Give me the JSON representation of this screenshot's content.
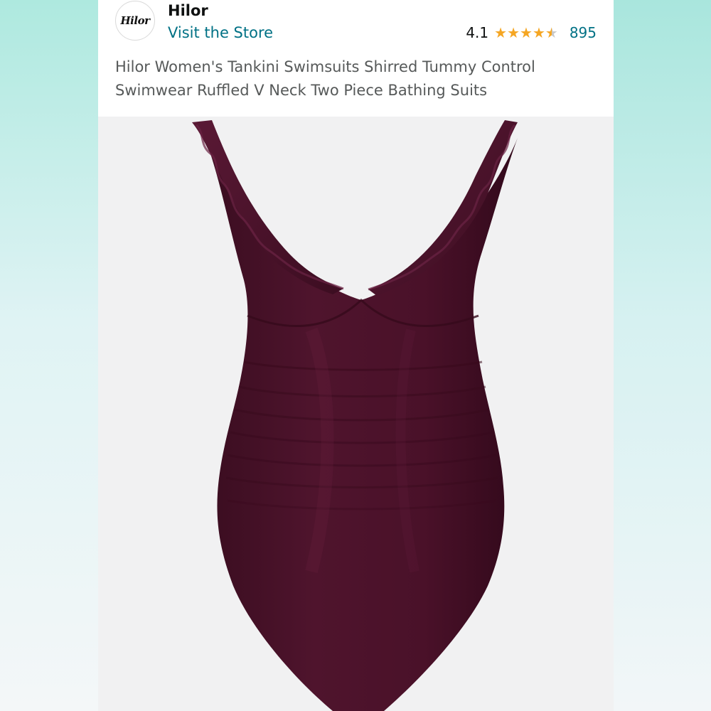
{
  "brand": {
    "logo_text": "Hilor",
    "name": "Hilor",
    "visit_store": "Visit the Store"
  },
  "rating": {
    "value": "4.1",
    "stars": 4.1,
    "review_count": "895"
  },
  "product": {
    "title": "Hilor Women's Tankini Swimsuits Shirred Tummy Control Swimwear Ruffled V Neck Two Piece Bathing Suits",
    "image_alt": "burgundy ruffled v-neck swimsuit"
  },
  "colors": {
    "link": "#007185",
    "star": "#f5a623",
    "swimsuit": "#4a1129"
  }
}
